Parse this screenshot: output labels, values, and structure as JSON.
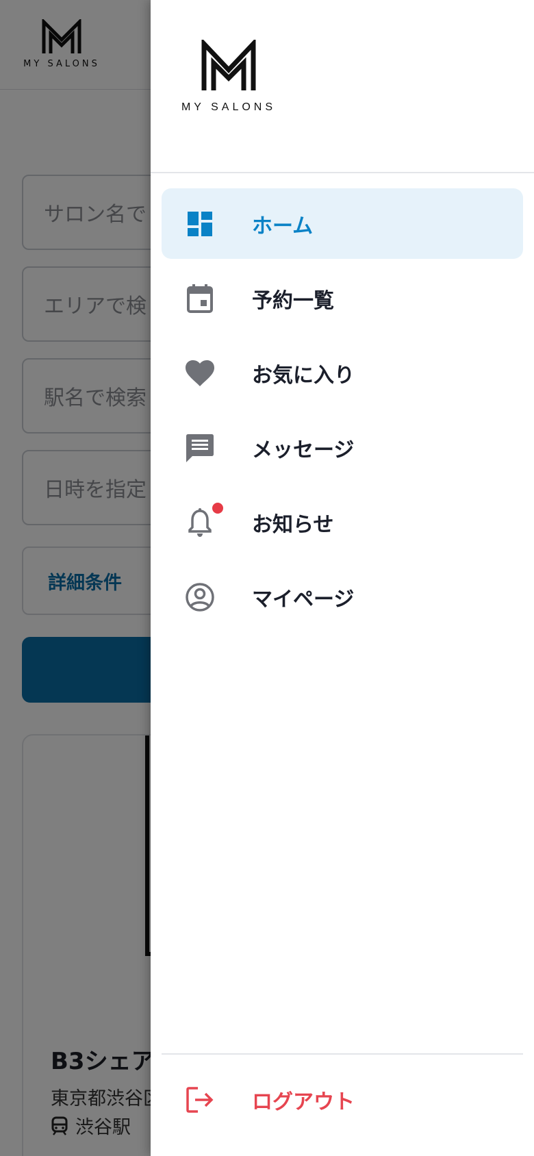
{
  "brand": {
    "name": "MY SALONS"
  },
  "background": {
    "search_fields": [
      {
        "placeholder": "サロン名で"
      },
      {
        "placeholder": "エリアで検"
      },
      {
        "placeholder": "駅名で検索"
      },
      {
        "placeholder": "日時を指定"
      }
    ],
    "detail_label": "詳細条件",
    "card": {
      "title": "B3シェア",
      "address": "東京都渋谷区",
      "station": "渋谷駅"
    }
  },
  "drawer": {
    "nav_items": [
      {
        "label": "ホーム",
        "icon": "dashboard-icon",
        "active": true
      },
      {
        "label": "予約一覧",
        "icon": "calendar-icon",
        "active": false
      },
      {
        "label": "お気に入り",
        "icon": "heart-icon",
        "active": false
      },
      {
        "label": "メッセージ",
        "icon": "message-icon",
        "active": false
      },
      {
        "label": "お知らせ",
        "icon": "bell-icon",
        "active": false,
        "badge": true
      },
      {
        "label": "マイページ",
        "icon": "account-circle-icon",
        "active": false
      }
    ],
    "logout_label": "ログアウト"
  },
  "colors": {
    "accent": "#0a82c6",
    "active_bg": "#e6f2fa",
    "logout": "#e64550",
    "badge": "#e63b46",
    "icon_gray": "#6f7177"
  }
}
